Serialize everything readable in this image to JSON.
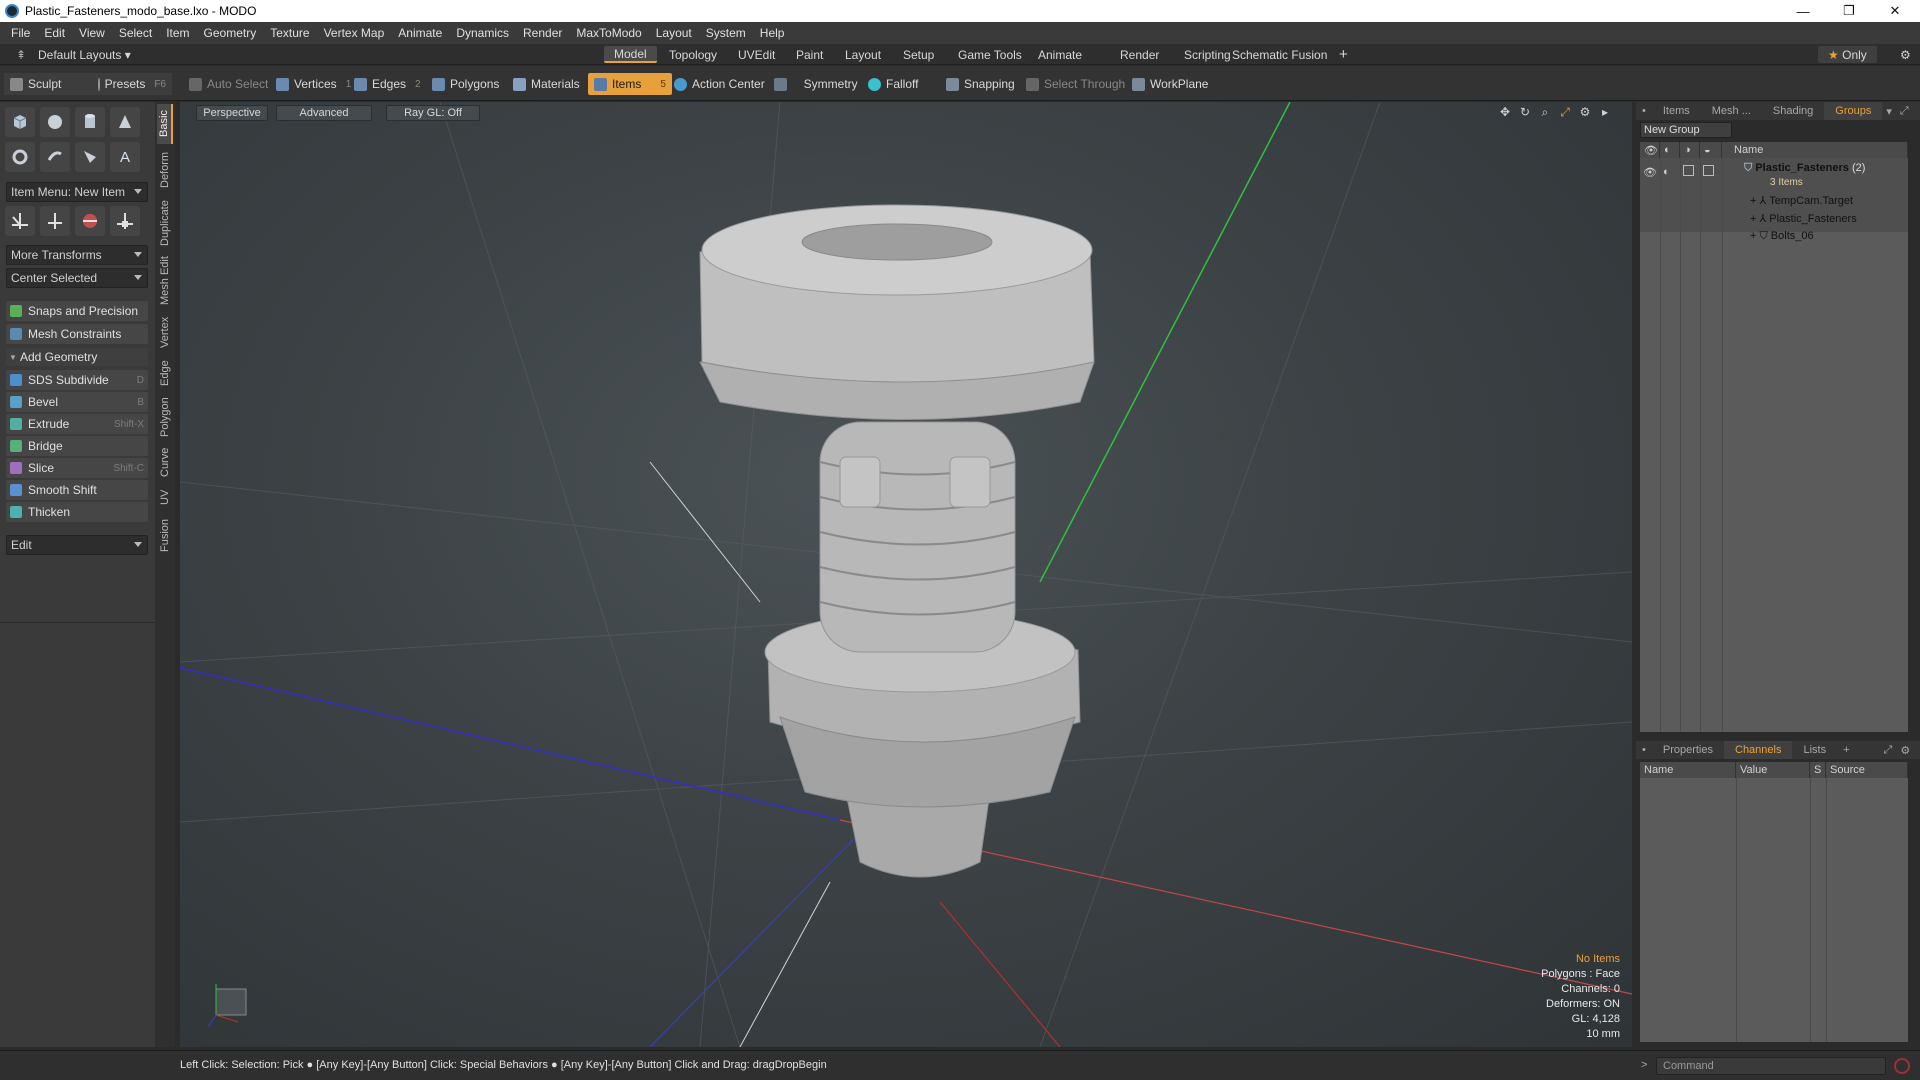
{
  "window": {
    "title": "Plastic_Fasteners_modo_base.lxo - MODO",
    "minimize": "—",
    "restore": "❐",
    "close": "✕"
  },
  "menu": [
    "File",
    "Edit",
    "View",
    "Select",
    "Item",
    "Geometry",
    "Texture",
    "Vertex Map",
    "Animate",
    "Dynamics",
    "Render",
    "MaxToModo",
    "Layout",
    "System",
    "Help"
  ],
  "layoutbar": {
    "layout_dropdown": "Default Layouts",
    "tabs": [
      "Model",
      "Topology",
      "UVEdit",
      "Paint",
      "Layout",
      "Setup",
      "Game Tools",
      "Animate",
      "Render",
      "Scripting",
      "Schematic Fusion"
    ],
    "active_tab": "Model",
    "add": "+",
    "only": "Only"
  },
  "toolbar": {
    "sculpt": "Sculpt",
    "presets": "Presets",
    "presets_key": "F6",
    "auto_select": "Auto Select",
    "vertices": "Vertices",
    "vertices_num": "1",
    "edges": "Edges",
    "edges_num": "2",
    "polygons": "Polygons",
    "materials": "Materials",
    "items": "Items",
    "items_num": "5",
    "action_center": "Action Center",
    "symmetry": "Symmetry",
    "falloff": "Falloff",
    "snapping": "Snapping",
    "select_through": "Select Through",
    "workplane": "WorkPlane"
  },
  "leftpanel": {
    "item_menu": "Item Menu: New Item",
    "more_transforms": "More Transforms",
    "center_selected": "Center Selected",
    "snaps": "Snaps and Precision",
    "mesh_constraints": "Mesh Constraints",
    "add_geometry": "Add Geometry",
    "tools": [
      {
        "label": "SDS Subdivide",
        "key": "D",
        "color": "#4a8fd0"
      },
      {
        "label": "Bevel",
        "key": "B",
        "color": "#5aa0c8"
      },
      {
        "label": "Extrude",
        "key": "Shift-X",
        "color": "#4fb0a0"
      },
      {
        "label": "Bridge",
        "key": "",
        "color": "#5ab07a"
      },
      {
        "label": "Slice",
        "key": "Shift-C",
        "color": "#a070c0"
      },
      {
        "label": "Smooth Shift",
        "key": "",
        "color": "#5a90d0"
      },
      {
        "label": "Thicken",
        "key": "",
        "color": "#50b0b0"
      }
    ],
    "edit": "Edit"
  },
  "vtabs": [
    "Basic",
    "Deform",
    "Duplicate",
    "Mesh Edit",
    "Vertex",
    "Edge",
    "Polygon",
    "Curve",
    "UV",
    "Fusion"
  ],
  "viewport": {
    "perspective": "Perspective",
    "advanced": "Advanced",
    "raygl": "Ray GL: Off",
    "hud": {
      "no_items": "No Items",
      "polygons": "Polygons : Face",
      "channels": "Channels: 0",
      "deformers": "Deformers: ON",
      "gl": "GL: 4,128",
      "scale": "10 mm"
    }
  },
  "rightpanel": {
    "top_tabs": [
      "Items",
      "Mesh ...",
      "Shading",
      "Groups"
    ],
    "active_top": "Groups",
    "new_group": "New Group",
    "name_col": "Name",
    "tree": {
      "root": "Plastic_Fasteners",
      "root_count": "(2)",
      "root_sub": "3 Items",
      "children": [
        "TempCam.Target",
        "Plastic_Fasteners",
        "Bolts_06"
      ]
    },
    "bottom_tabs": [
      "Properties",
      "Channels",
      "Lists"
    ],
    "active_bottom": "Channels",
    "add": "+",
    "cols": [
      "Name",
      "Value",
      "S",
      "Source"
    ]
  },
  "status": {
    "text": "Left Click: Selection: Pick ● [Any Key]-[Any Button] Click: Special Behaviors ● [Any Key]-[Any Button] Click and Drag: dragDropBegin",
    "command_placeholder": "Command"
  },
  "colors": {
    "accent": "#e8a13a",
    "x_axis": "#c03030",
    "y_axis": "#30c040",
    "z_axis": "#3040d0"
  }
}
